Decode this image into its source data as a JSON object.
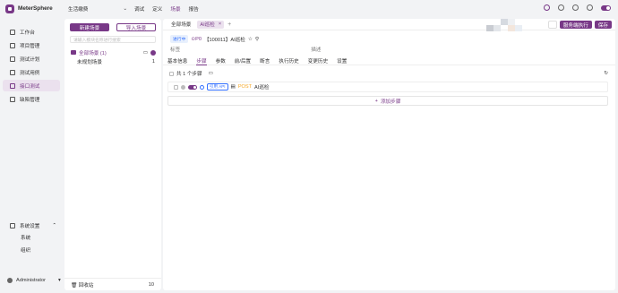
{
  "app": {
    "name": "MeterSphere",
    "project": "生活缴费"
  },
  "topnav": [
    {
      "label": "调试"
    },
    {
      "label": "定义"
    },
    {
      "label": "场景"
    },
    {
      "label": "报告"
    }
  ],
  "sidebar": {
    "items": [
      {
        "label": "工作台",
        "icon": "dashboard-icon"
      },
      {
        "label": "项目管理",
        "icon": "project-icon"
      },
      {
        "label": "测试计划",
        "icon": "plan-icon"
      },
      {
        "label": "测试用例",
        "icon": "case-icon"
      },
      {
        "label": "接口测试",
        "icon": "api-icon"
      },
      {
        "label": "缺陷管理",
        "icon": "bug-icon"
      }
    ],
    "system": {
      "label": "系统设置",
      "subitems": [
        "系统",
        "组织"
      ]
    },
    "user": "Administrator"
  },
  "scene_panel": {
    "new_button": "新建场景",
    "import_button": "导入场景",
    "search_placeholder": "请输入模块名称进行搜索",
    "tree_root": "全部场景 (1)",
    "tree_child": {
      "label": "未规划场景",
      "count": "1"
    },
    "recycle": {
      "label": "回收站",
      "count": "10"
    }
  },
  "tabs": [
    {
      "label": "全部场景"
    },
    {
      "label": "AI巡检"
    }
  ],
  "actions": {
    "execute": "服务端执行",
    "save": "保存"
  },
  "scene": {
    "status": "进行中",
    "priority": "P0",
    "title": "【100011】AI巡检",
    "tag_label": "标签",
    "desc_label": "描述"
  },
  "subtabs": [
    "基本信息",
    "步骤",
    "参数",
    "前/后置",
    "断言",
    "执行历史",
    "变更历史",
    "设置"
  ],
  "steps": {
    "count_label": "共 1 个步骤",
    "items": [
      {
        "type": "引用 API",
        "method": "POST",
        "name": "AI巡检"
      }
    ],
    "add_label": "添加步骤"
  },
  "colors": {
    "accent": "#783887",
    "accent_bg": "#ebe1ee",
    "blue": "#3370ff"
  }
}
